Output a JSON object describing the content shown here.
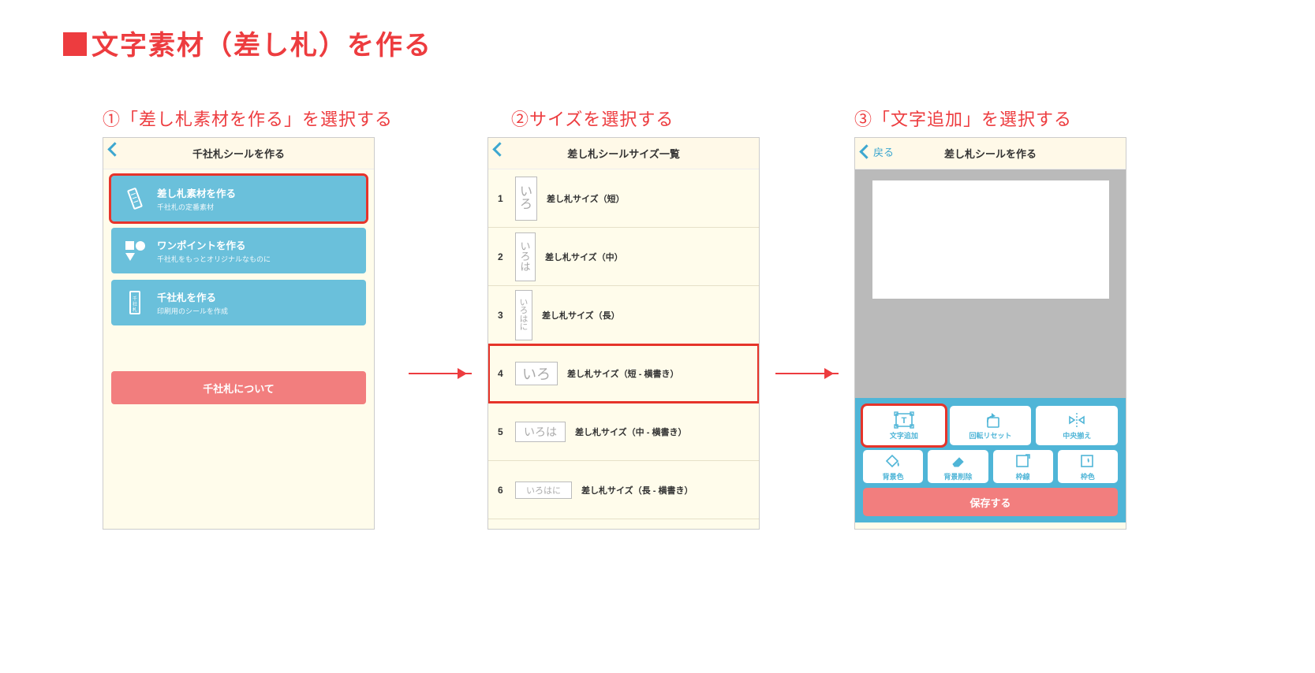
{
  "page_title": "文字素材（差し札）を作る",
  "steps": {
    "s1": {
      "label": "①「差し札素材を作る」を選択する"
    },
    "s2": {
      "label": "②サイズを選択する"
    },
    "s3": {
      "label": "③「文字追加」を選択する"
    }
  },
  "screen1": {
    "nav_title": "千社札シールを作る",
    "back_label": "",
    "cards": [
      {
        "title": "差し札素材を作る",
        "sub": "千社札の定番素材"
      },
      {
        "title": "ワンポイントを作る",
        "sub": "千社札をもっとオリジナルなものに"
      },
      {
        "title": "千社札を作る",
        "sub": "印刷用のシールを作成"
      }
    ],
    "about": "千社札について"
  },
  "screen2": {
    "nav_title": "差し札シールサイズ一覧",
    "items": [
      {
        "num": "1",
        "thumb": "いろ",
        "label": "差し札サイズ（短）"
      },
      {
        "num": "2",
        "thumb": "いろは",
        "label": "差し札サイズ（中）"
      },
      {
        "num": "3",
        "thumb": "いろはに",
        "label": "差し札サイズ（長）"
      },
      {
        "num": "4",
        "thumb": "いろ",
        "label": "差し札サイズ（短 - 横書き）"
      },
      {
        "num": "5",
        "thumb": "いろは",
        "label": "差し札サイズ（中 - 横書き）"
      },
      {
        "num": "6",
        "thumb": "いろはに",
        "label": "差し札サイズ（長 - 横書き）"
      }
    ]
  },
  "screen3": {
    "nav_title": "差し札シールを作る",
    "back_label": "戻る",
    "tools_row1": [
      {
        "key": "add-text",
        "label": "文字追加"
      },
      {
        "key": "reset-rot",
        "label": "回転リセット"
      },
      {
        "key": "center",
        "label": "中央揃え"
      }
    ],
    "tools_row2": [
      {
        "key": "bg-color",
        "label": "背景色"
      },
      {
        "key": "bg-remove",
        "label": "背景削除"
      },
      {
        "key": "frame",
        "label": "枠線"
      },
      {
        "key": "frame-col",
        "label": "枠色"
      }
    ],
    "save": "保存する"
  }
}
